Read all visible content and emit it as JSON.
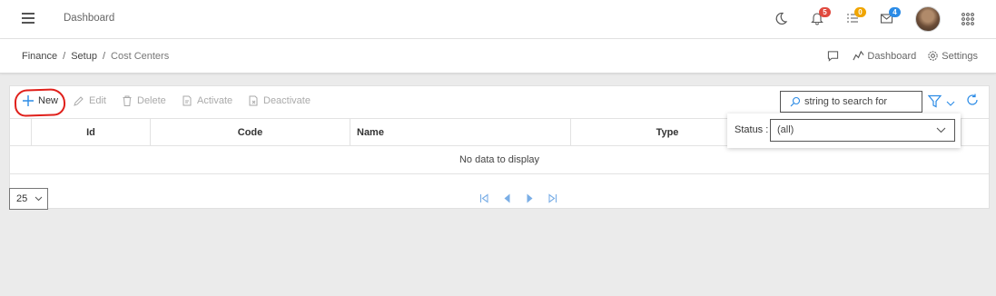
{
  "header": {
    "title": "Dashboard",
    "notifications": {
      "count": "5",
      "color": "#e04a3f"
    },
    "tasks": {
      "count": "0",
      "color": "#f0a500"
    },
    "messages": {
      "count": "4",
      "color": "#2b8be6"
    },
    "icons": [
      "hamburger-icon",
      "moon-icon",
      "bell-icon",
      "tasks-icon",
      "mail-icon",
      "avatar",
      "apps-grid-icon"
    ]
  },
  "breadcrumb": {
    "items": [
      "Finance",
      "Setup",
      "Cost Centers"
    ],
    "separator": "/"
  },
  "page_actions": {
    "dashboard_label": "Dashboard",
    "settings_label": "Settings"
  },
  "toolbar": {
    "new_label": "New",
    "edit_label": "Edit",
    "delete_label": "Delete",
    "activate_label": "Activate",
    "deactivate_label": "Deactivate",
    "search_placeholder": "string to search for"
  },
  "grid": {
    "columns": [
      "Id",
      "Code",
      "Name",
      "Type"
    ],
    "empty_text": "No data to display"
  },
  "pager": {
    "page_size": "25"
  },
  "filter": {
    "status_label": "Status :",
    "status_value": "(all)"
  },
  "colors": {
    "accent": "#2b8be6",
    "highlight_annotation": "#e0201b"
  }
}
